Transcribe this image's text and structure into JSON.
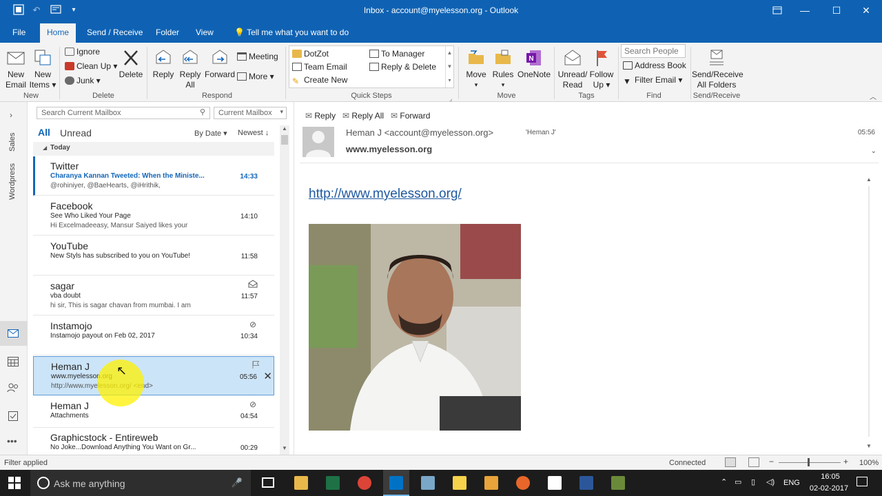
{
  "window": {
    "title": "Inbox - account@myelesson.org - Outlook",
    "controls": {
      "restore_icon": "restore-ribbon-icon",
      "minimize": "—",
      "maximize": "☐",
      "close": "✕"
    }
  },
  "tabs": [
    "File",
    "Home",
    "Send / Receive",
    "Folder",
    "View"
  ],
  "tell_me": "Tell me what you want to do",
  "ribbon": {
    "new_email": [
      "New",
      "Email"
    ],
    "new_items": [
      "New",
      "Items ▾"
    ],
    "ignore": "Ignore",
    "clean_up": "Clean Up ▾",
    "junk": "Junk ▾",
    "delete": "Delete",
    "reply": "Reply",
    "reply_all": [
      "Reply",
      "All"
    ],
    "forward": "Forward",
    "meeting": "Meeting",
    "more": "More ▾",
    "quick_steps": [
      "DotZot",
      "To Manager",
      "Team Email",
      "Reply & Delete",
      "Create New"
    ],
    "move": "Move",
    "rules": "Rules",
    "onenote": "OneNote",
    "unread_read": [
      "Unread/",
      "Read"
    ],
    "follow_up": [
      "Follow",
      "Up ▾"
    ],
    "search_people": "Search People",
    "address_book": "Address Book",
    "filter_email": "Filter Email ▾",
    "send_receive_all": [
      "Send/Receive",
      "All Folders"
    ],
    "groups": [
      "New",
      "Delete",
      "Respond",
      "Quick Steps",
      "Move",
      "Tags",
      "Find",
      "Send/Receive"
    ]
  },
  "rail": {
    "sales": "Sales",
    "wordpress": "Wordpress"
  },
  "list": {
    "search_placeholder": "Search Current Mailbox",
    "scope": "Current Mailbox",
    "filter_all": "All",
    "filter_unread": "Unread",
    "sort_by": "By Date ▾",
    "sort_order": "Newest ↓",
    "group_header": "Today",
    "items": [
      {
        "from": "Twitter",
        "subject": "Charanya Kannan Tweeted: When the Ministe...",
        "preview": "@rohiniyer, @BaeHearts, @iHrithik,",
        "time": "14:33"
      },
      {
        "from": "Facebook",
        "subject": "See Who Liked Your Page",
        "preview": "Hi Excelmadeeasy,   Mansur Saiyed likes your",
        "time": "14:10"
      },
      {
        "from": "YouTube",
        "subject": "New Styls has subscribed to you on YouTube!",
        "preview": "",
        "time": "11:58"
      },
      {
        "from": "sagar",
        "subject": "vba doubt",
        "preview": "hi sir,  This is sagar chavan from mumbai. I am",
        "time": "11:57"
      },
      {
        "from": "Instamojo",
        "subject": "Instamojo payout on Feb 02, 2017",
        "preview": "",
        "time": "10:34"
      },
      {
        "from": "Heman J",
        "subject": "www.myelesson.org",
        "preview": "http://www.myelesson.org/ <end>",
        "time": "05:56"
      },
      {
        "from": "Heman J",
        "subject": "Attachments",
        "preview": "",
        "time": "04:54"
      },
      {
        "from": "Graphicstock - Entireweb",
        "subject": "No Joke...Download Anything You Want on Gr...",
        "preview": "",
        "time": "00:29"
      }
    ]
  },
  "reading": {
    "reply": "Reply",
    "reply_all": "Reply All",
    "forward": "Forward",
    "sender": "Heman J <account@myelesson.org>",
    "to": "'Heman J'",
    "time": "05:56",
    "subject": "www.myelesson.org",
    "link": "http://www.myelesson.org/"
  },
  "status": {
    "left": "Filter applied",
    "connected": "Connected",
    "zoom": "100%"
  },
  "taskbar": {
    "search": "Ask me anything",
    "lang": "ENG",
    "time": "16:05",
    "date": "02-02-2017"
  },
  "colors": {
    "accent": "#0f62b3",
    "selected": "#cce4f7",
    "link": "#1e58a0"
  }
}
